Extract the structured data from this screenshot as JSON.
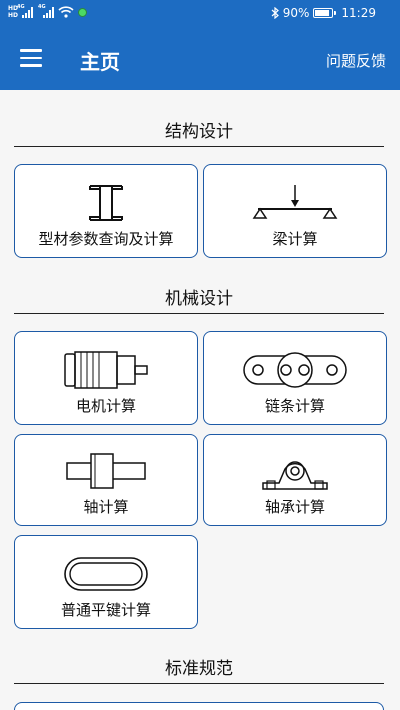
{
  "status_bar": {
    "left_badges": [
      "HD",
      "HD"
    ],
    "network_labels": [
      "4G",
      "4G"
    ],
    "battery": "90%",
    "time": "11:29"
  },
  "header": {
    "title": "主页",
    "feedback_label": "问题反馈"
  },
  "sections": [
    {
      "title": "结构设计",
      "cards": [
        {
          "label": "型材参数查询及计算",
          "icon": "i-beam-icon"
        },
        {
          "label": "梁计算",
          "icon": "beam-load-icon"
        }
      ]
    },
    {
      "title": "机械设计",
      "cards": [
        {
          "label": "电机计算",
          "icon": "motor-icon"
        },
        {
          "label": "链条计算",
          "icon": "chain-icon"
        },
        {
          "label": "轴计算",
          "icon": "shaft-icon"
        },
        {
          "label": "轴承计算",
          "icon": "bearing-block-icon"
        },
        {
          "label": "普通平键计算",
          "icon": "flat-key-icon"
        }
      ]
    },
    {
      "title": "标准规范",
      "cards": []
    }
  ],
  "colors": {
    "header": "#1d6cc2",
    "card_border": "#1d5aa6",
    "background": "#f6f6f6"
  }
}
